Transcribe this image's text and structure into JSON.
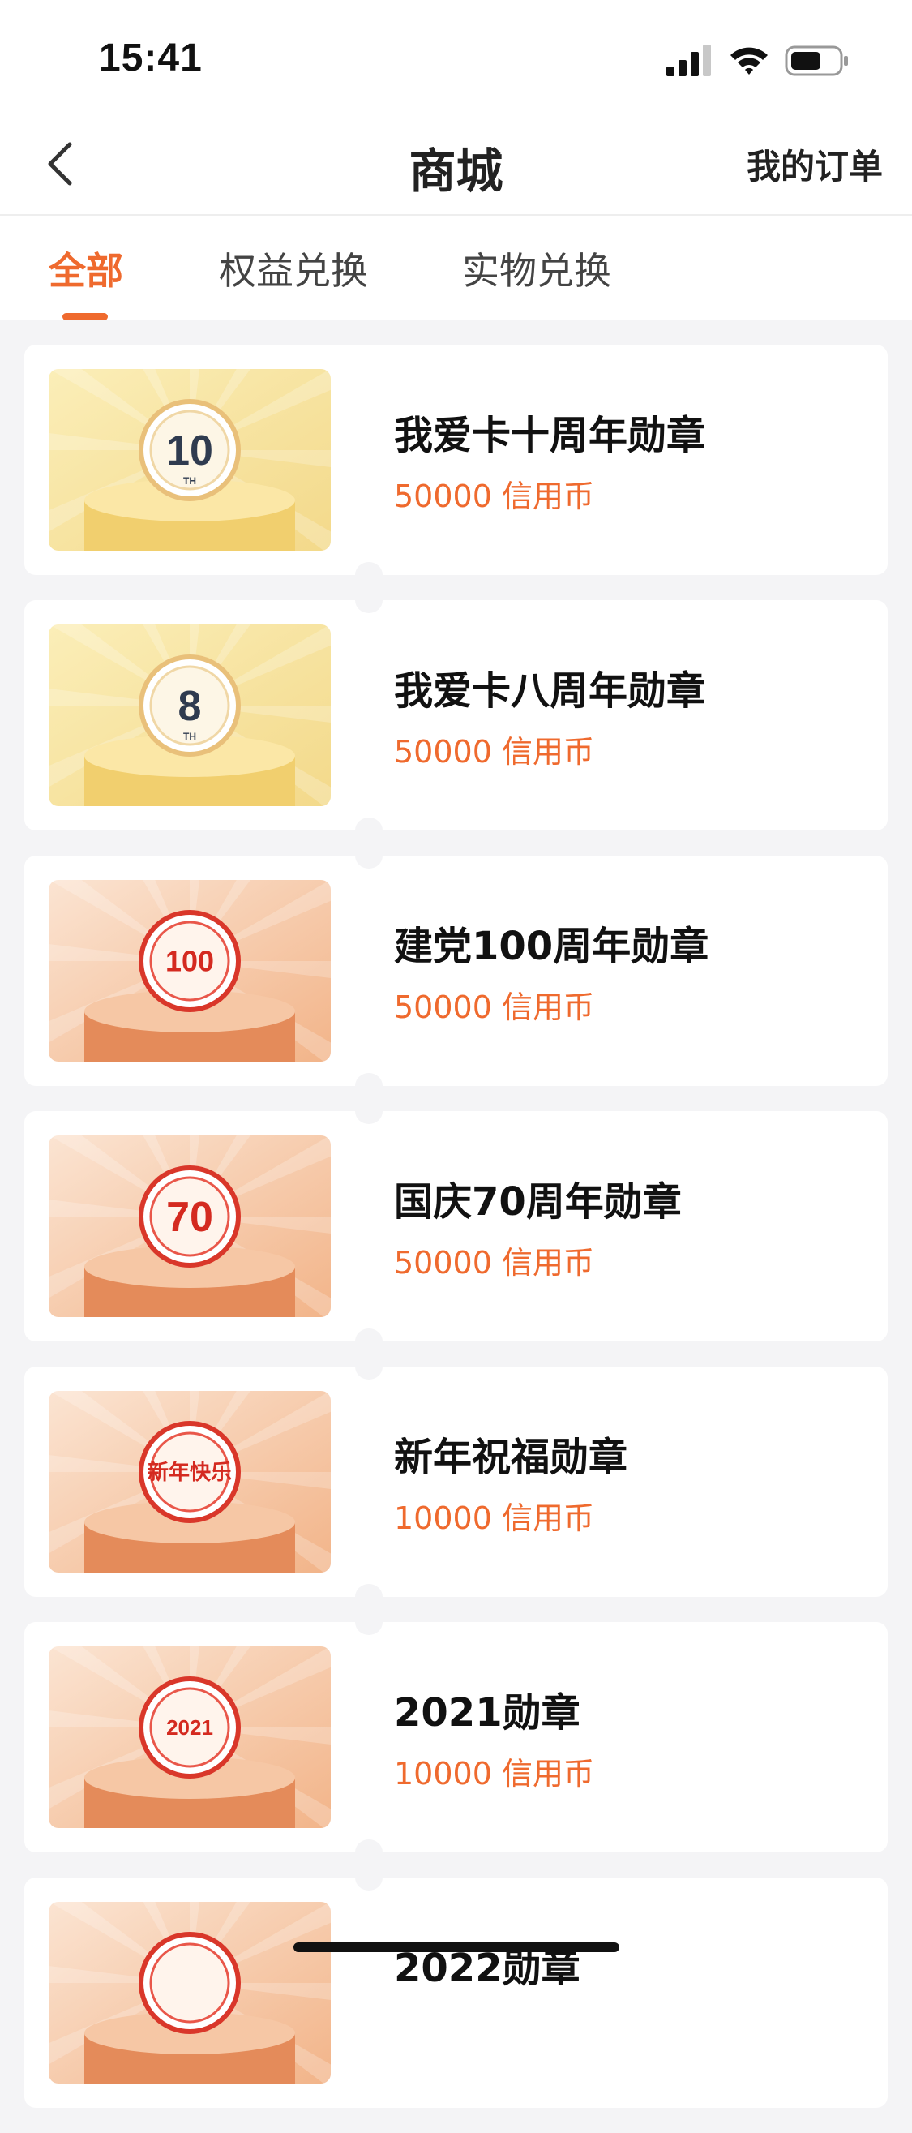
{
  "status_bar": {
    "time": "15:41"
  },
  "header": {
    "title": "商城",
    "right_action": "我的订单"
  },
  "tabs": [
    {
      "label": "全部",
      "active": true
    },
    {
      "label": "权益兑换",
      "active": false
    },
    {
      "label": "实物兑换",
      "active": false
    }
  ],
  "products": [
    {
      "name": "我爱卡十周年勋章",
      "price": "50000 信用币",
      "badge_text": "10",
      "badge_sub": "TH",
      "theme": "gold"
    },
    {
      "name": "我爱卡八周年勋章",
      "price": "50000 信用币",
      "badge_text": "8",
      "badge_sub": "TH",
      "theme": "gold"
    },
    {
      "name": "建党100周年勋章",
      "price": "50000 信用币",
      "badge_text": "100",
      "badge_sub": "",
      "theme": "red"
    },
    {
      "name": "国庆70周年勋章",
      "price": "50000 信用币",
      "badge_text": "70",
      "badge_sub": "",
      "theme": "red"
    },
    {
      "name": "新年祝福勋章",
      "price": "10000 信用币",
      "badge_text": "新年快乐",
      "badge_sub": "",
      "theme": "red"
    },
    {
      "name": "2021勋章",
      "price": "10000 信用币",
      "badge_text": "2021",
      "badge_sub": "",
      "theme": "red"
    },
    {
      "name": "2022勋章",
      "price": "",
      "badge_text": "",
      "badge_sub": "",
      "theme": "red"
    }
  ],
  "colors": {
    "accent": "#ef6a2e",
    "background": "#f4f4f6"
  }
}
